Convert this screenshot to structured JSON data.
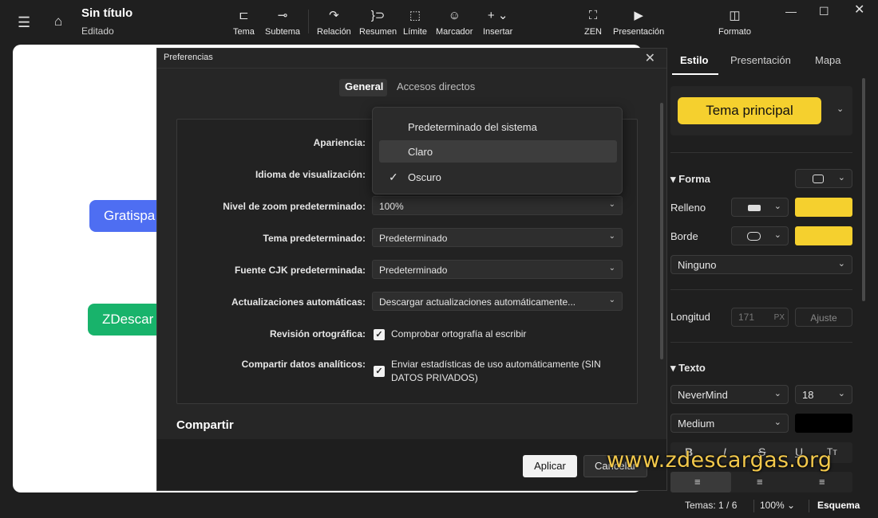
{
  "titlebar": {
    "title": "Sin título",
    "subtitle": "Editado",
    "window_controls": [
      "minimize-icon",
      "maximize-icon",
      "close-icon"
    ]
  },
  "toolbar": {
    "items": [
      {
        "label": "Tema",
        "icon": "topic-icon"
      },
      {
        "label": "Subtema",
        "icon": "subtopic-icon"
      },
      {
        "label": "Relación",
        "icon": "relationship-icon"
      },
      {
        "label": "Resumen",
        "icon": "summary-icon"
      },
      {
        "label": "Límite",
        "icon": "boundary-icon"
      },
      {
        "label": "Marcador",
        "icon": "marker-icon"
      },
      {
        "label": "Insertar",
        "icon": "insert-icon"
      },
      {
        "label": "ZEN",
        "icon": "zen-icon"
      },
      {
        "label": "Presentación",
        "icon": "presentation-icon"
      },
      {
        "label": "Formato",
        "icon": "format-icon"
      }
    ]
  },
  "canvas": {
    "nodes": [
      {
        "text": "Gratispa",
        "color": "#4e6ef2"
      },
      {
        "text": "ZDescar",
        "color": "#18b36b"
      }
    ]
  },
  "dialog": {
    "title": "Preferencias",
    "tabs": [
      {
        "label": "General"
      },
      {
        "label": "Accesos directos"
      }
    ],
    "rows": {
      "appearance": {
        "label": "Apariencia:"
      },
      "language": {
        "label": "Idioma de visualización:"
      },
      "zoom": {
        "label": "Nivel de zoom predeterminado:",
        "value": "100%"
      },
      "theme": {
        "label": "Tema predeterminado:",
        "value": "Predeterminado"
      },
      "cjk_font": {
        "label": "Fuente CJK predeterminada:",
        "value": "Predeterminado"
      },
      "updates": {
        "label": "Actualizaciones automáticas:",
        "value": "Descargar actualizaciones automáticamente..."
      },
      "spellcheck": {
        "label": "Revisión ortográfica:",
        "checkbox_text": "Comprobar ortografía al escribir",
        "checked": true
      },
      "analytics": {
        "label": "Compartir datos analíticos:",
        "checkbox_text": "Enviar estadísticas de uso automáticamente (SIN DATOS PRIVADOS)",
        "checked": true
      }
    },
    "section_heading": "Compartir",
    "apply_label": "Aplicar",
    "cancel_label": "Cancelar"
  },
  "appearance_dropdown": {
    "options": [
      {
        "label": "Predeterminado del sistema",
        "highlighted": false,
        "checked": false
      },
      {
        "label": "Claro",
        "highlighted": true,
        "checked": false
      },
      {
        "label": "Oscuro",
        "highlighted": false,
        "checked": true
      }
    ]
  },
  "right_panel": {
    "tabs": [
      {
        "label": "Estilo"
      },
      {
        "label": "Presentación"
      },
      {
        "label": "Mapa"
      }
    ],
    "topic_style": "Tema principal",
    "shape_section": "Forma",
    "fill_label": "Relleno",
    "border_label": "Borde",
    "border_style": "Ninguno",
    "length_label": "Longitud",
    "length_value": "171",
    "length_unit": "PX",
    "adjust_label": "Ajuste",
    "text_section": "Texto",
    "font_family": "NeverMind",
    "font_size": "18",
    "font_weight": "Medium",
    "accent_color": "#f5d02e"
  },
  "statusbar": {
    "topics": "Temas: 1 / 6",
    "zoom": "100%",
    "view": "Esquema"
  },
  "watermark": "www.zdescargas.org"
}
